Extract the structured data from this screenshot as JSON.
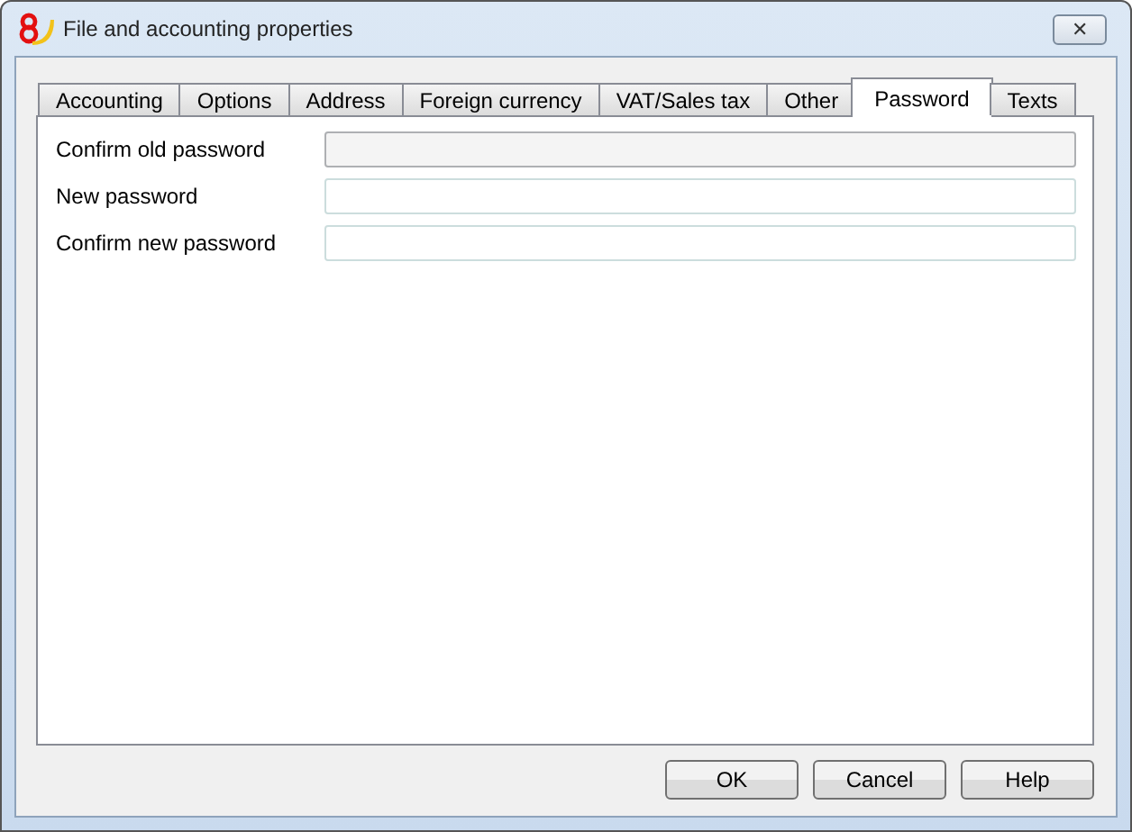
{
  "window": {
    "title": "File and accounting properties",
    "close_symbol": "✕"
  },
  "tabs": [
    {
      "label": "Accounting",
      "selected": false
    },
    {
      "label": "Options",
      "selected": false
    },
    {
      "label": "Address",
      "selected": false
    },
    {
      "label": "Foreign currency",
      "selected": false
    },
    {
      "label": "VAT/Sales tax",
      "selected": false
    },
    {
      "label": "Other",
      "selected": false
    },
    {
      "label": "Password",
      "selected": true
    },
    {
      "label": "Texts",
      "selected": false
    }
  ],
  "fields": [
    {
      "label": "Confirm old password",
      "disabled": true
    },
    {
      "label": "New password",
      "disabled": false
    },
    {
      "label": "Confirm new password",
      "disabled": false
    }
  ],
  "buttons": [
    "OK",
    "Cancel",
    "Help"
  ]
}
